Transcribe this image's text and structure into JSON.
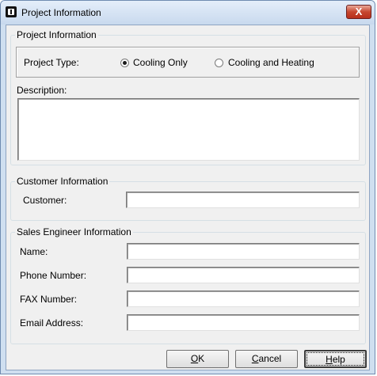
{
  "window": {
    "title": "Project Information",
    "close_glyph": "X"
  },
  "project": {
    "group_label": "Project Information",
    "type_label": "Project Type:",
    "options": [
      {
        "label": "Cooling Only",
        "selected": true
      },
      {
        "label": "Cooling and Heating",
        "selected": false
      }
    ],
    "description_label": "Description:",
    "description_value": ""
  },
  "customer": {
    "group_label": "Customer Information",
    "customer_label": "Customer:",
    "customer_value": ""
  },
  "sales": {
    "group_label": "Sales Engineer Information",
    "name_label": "Name:",
    "phone_label": "Phone Number:",
    "fax_label": "FAX Number:",
    "email_label": "Email Address:",
    "name_value": "",
    "phone_value": "",
    "fax_value": "",
    "email_value": ""
  },
  "buttons": {
    "ok": {
      "pre": "",
      "mnemonic": "O",
      "post": "K"
    },
    "cancel": {
      "pre": "",
      "mnemonic": "C",
      "post": "ancel"
    },
    "help": {
      "pre": "",
      "mnemonic": "H",
      "post": "elp"
    }
  }
}
